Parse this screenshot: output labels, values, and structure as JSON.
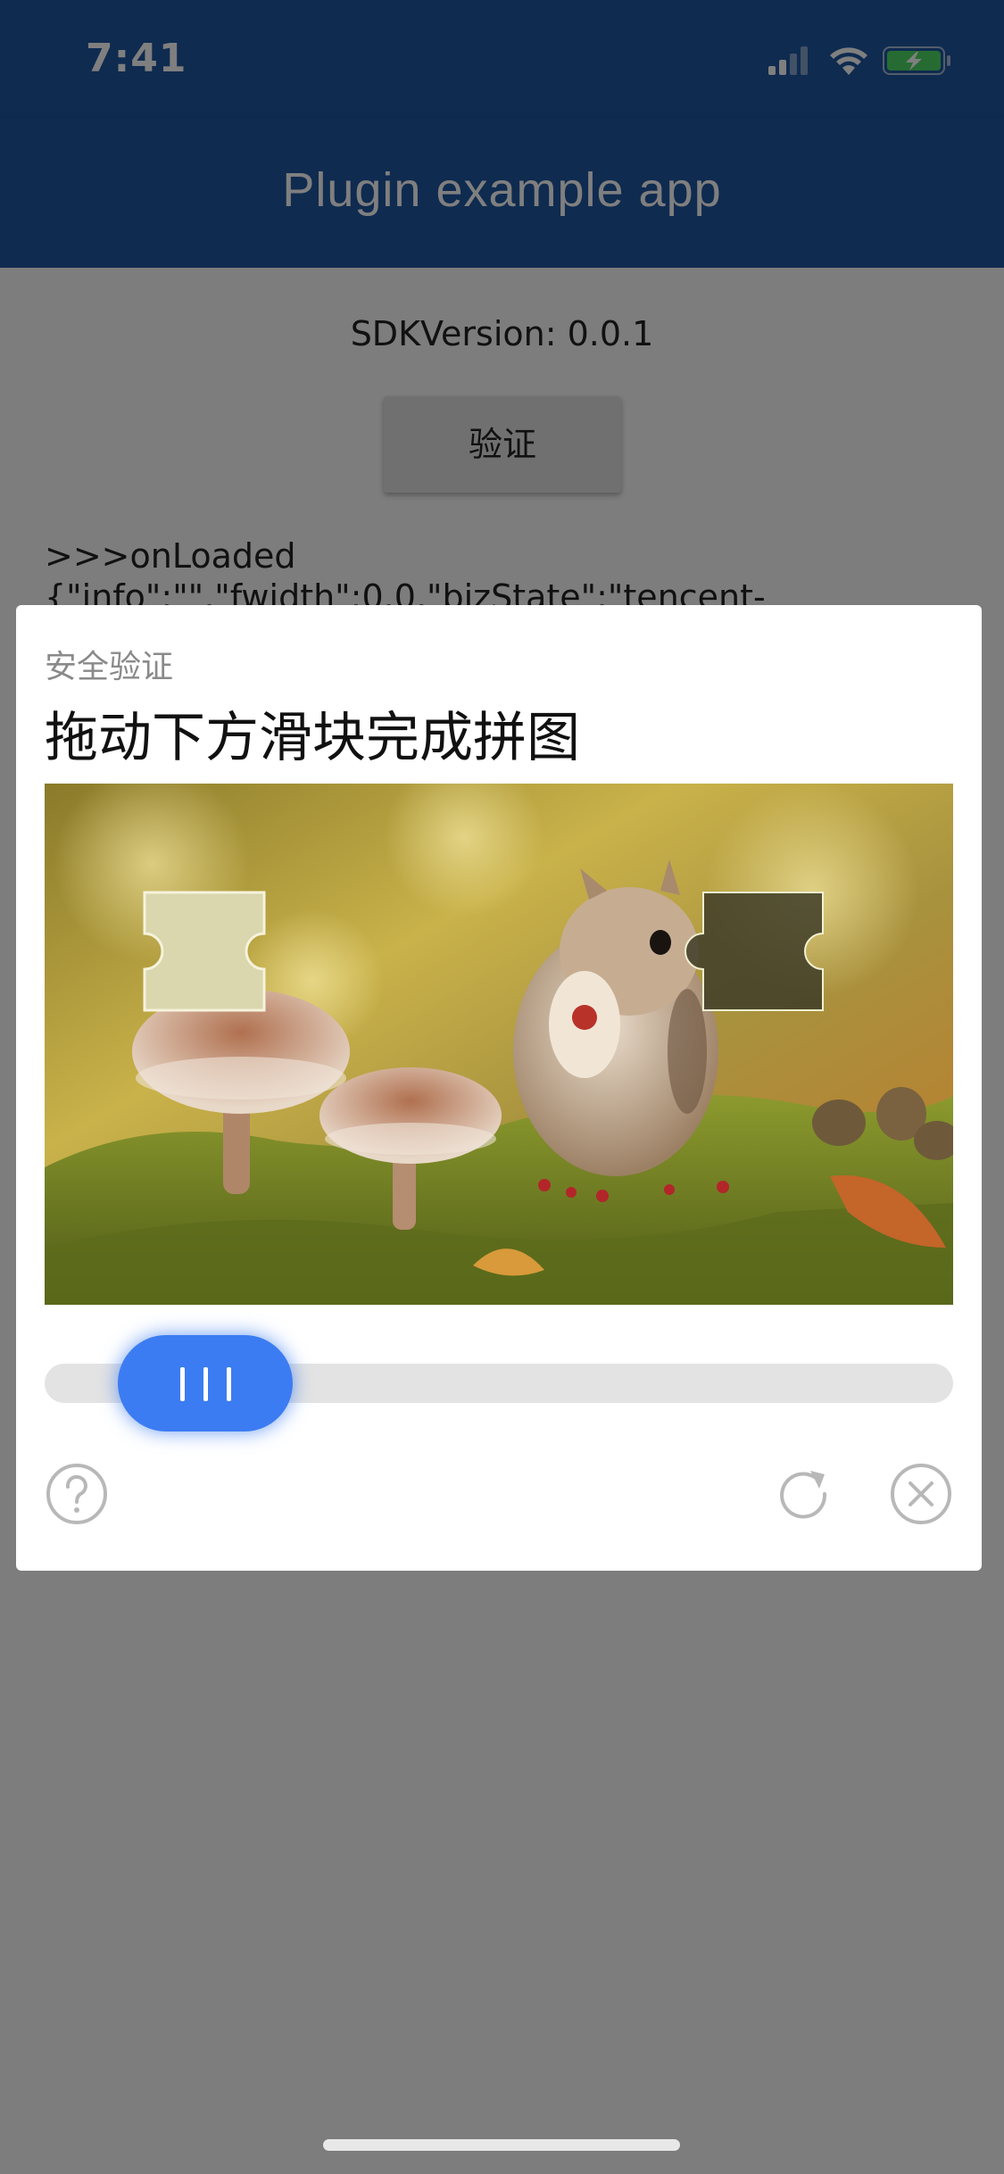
{
  "status_bar": {
    "time": "7:41"
  },
  "app_bar": {
    "title": "Plugin example app"
  },
  "content": {
    "sdk_version": "SDKVersion: 0.0.1",
    "verify_button_label": "验证",
    "log": ">>>onLoaded\n{\"info\":\"\",\"fwidth\":0.0,\"bizState\":\"tencent-"
  },
  "captcha": {
    "caption": "安全验证",
    "title": "拖动下方滑块完成拼图",
    "slider_progress": 0.15,
    "icons": {
      "help": "help-icon",
      "refresh": "refresh-icon",
      "close": "close-icon"
    },
    "colors": {
      "accent": "#3c7cf2",
      "track": "#e3e3e3"
    }
  },
  "colors": {
    "app_bar": "#1f56a0",
    "battery": "#4cd964"
  }
}
